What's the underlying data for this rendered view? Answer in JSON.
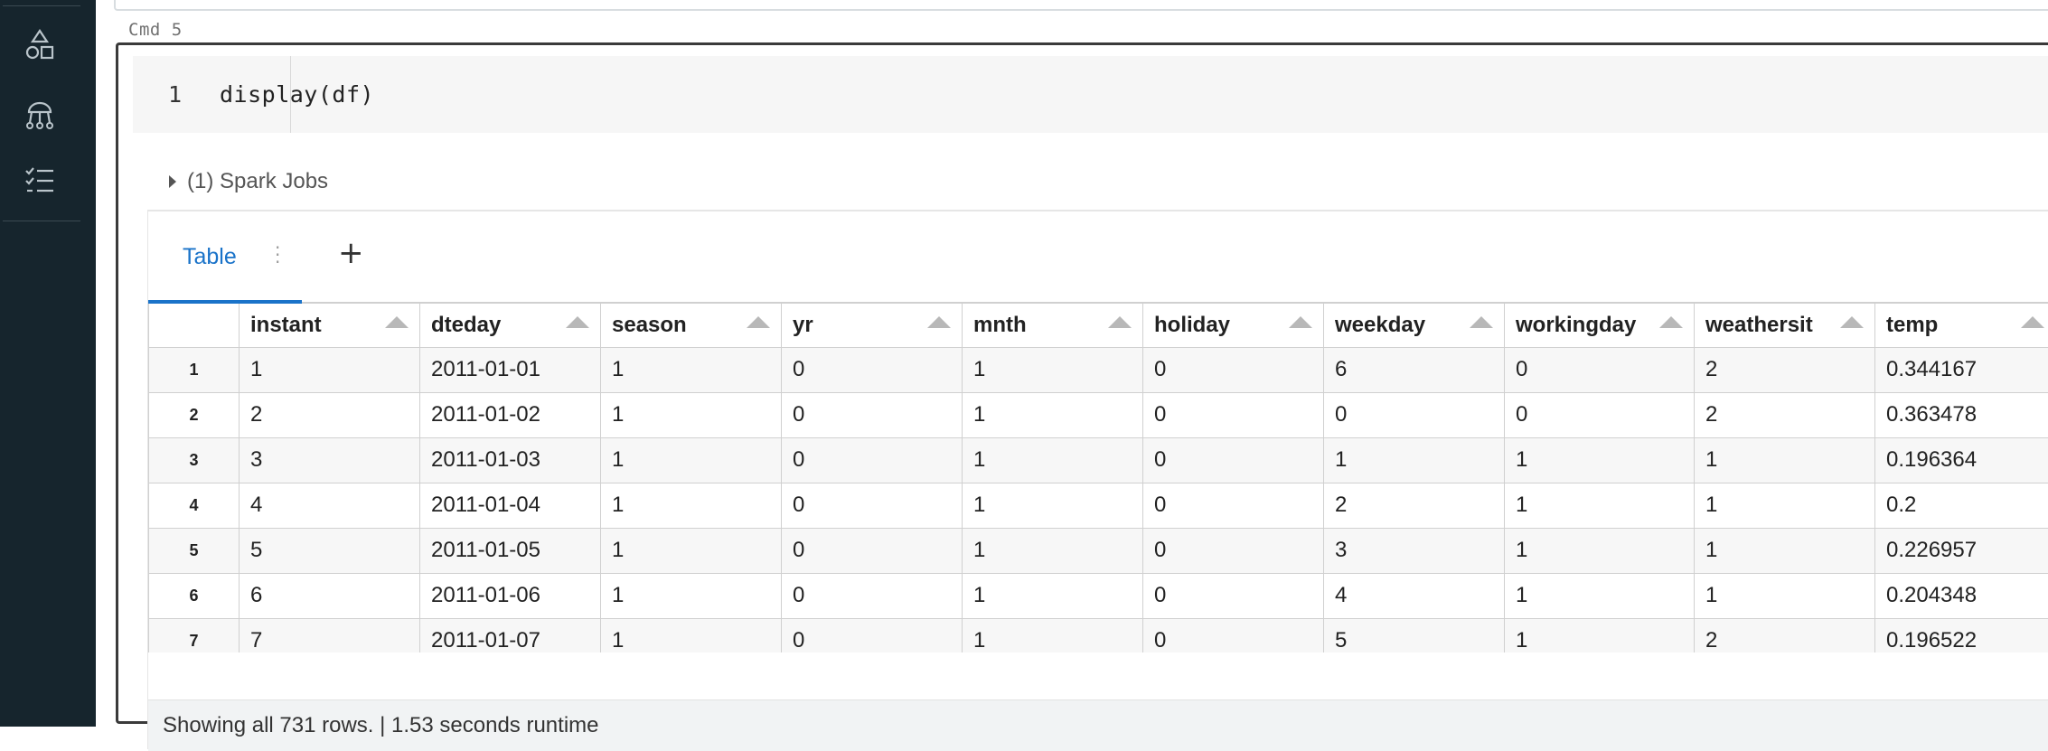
{
  "cell": {
    "label": "Cmd 5",
    "line_number": "1",
    "code": "display(df)"
  },
  "spark_jobs": {
    "label": "(1) Spark Jobs"
  },
  "output_tabs": {
    "table_label": "Table",
    "menu_icon": "kebab-menu-icon",
    "add_label": "+"
  },
  "table": {
    "columns": [
      "instant",
      "dteday",
      "season",
      "yr",
      "mnth",
      "holiday",
      "weekday",
      "workingday",
      "weathersit",
      "temp"
    ],
    "rows": [
      {
        "num": "1",
        "cells": [
          "1",
          "2011-01-01",
          "1",
          "0",
          "1",
          "0",
          "6",
          "0",
          "2",
          "0.344167"
        ]
      },
      {
        "num": "2",
        "cells": [
          "2",
          "2011-01-02",
          "1",
          "0",
          "1",
          "0",
          "0",
          "0",
          "2",
          "0.363478"
        ]
      },
      {
        "num": "3",
        "cells": [
          "3",
          "2011-01-03",
          "1",
          "0",
          "1",
          "0",
          "1",
          "1",
          "1",
          "0.196364"
        ]
      },
      {
        "num": "4",
        "cells": [
          "4",
          "2011-01-04",
          "1",
          "0",
          "1",
          "0",
          "2",
          "1",
          "1",
          "0.2"
        ]
      },
      {
        "num": "5",
        "cells": [
          "5",
          "2011-01-05",
          "1",
          "0",
          "1",
          "0",
          "3",
          "1",
          "1",
          "0.226957"
        ]
      },
      {
        "num": "6",
        "cells": [
          "6",
          "2011-01-06",
          "1",
          "0",
          "1",
          "0",
          "4",
          "1",
          "1",
          "0.204348"
        ]
      },
      {
        "num": "7",
        "cells": [
          "7",
          "2011-01-07",
          "1",
          "0",
          "1",
          "0",
          "5",
          "1",
          "2",
          "0.196522"
        ]
      }
    ]
  },
  "footer": {
    "status": "Showing all 731 rows.  |  1.53 seconds runtime"
  },
  "sidebar": {
    "icons": [
      "shapes-icon",
      "model-tree-icon",
      "checklist-icon"
    ]
  },
  "colors": {
    "sidebar_bg": "#16252d",
    "accent": "#1a73c9",
    "footer_bg": "#f1f3f4"
  }
}
